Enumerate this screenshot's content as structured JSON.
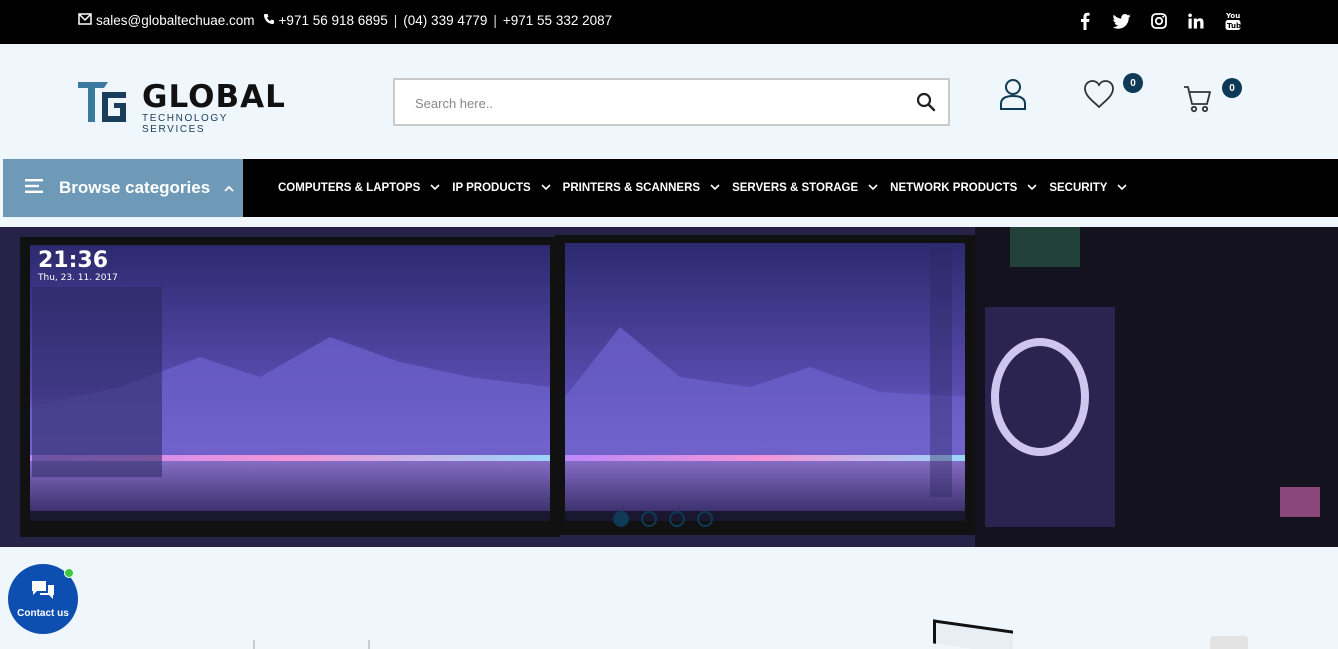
{
  "topbar": {
    "email": "sales@globaltechuae.com",
    "phones": [
      "+971 56 918 6895",
      "(04) 339 4779",
      "+971 55 332 2087"
    ],
    "socials": [
      "facebook-icon",
      "twitter-icon",
      "instagram-icon",
      "linkedin-icon",
      "youtube-icon"
    ]
  },
  "header": {
    "logo_main": "GLOBAL",
    "logo_sub": "TECHNOLOGY  SERVICES",
    "search_placeholder": "Search here..",
    "wishlist_count": "0",
    "cart_count": "0"
  },
  "nav": {
    "browse_label": "Browse categories",
    "items": [
      {
        "label": "COMPUTERS & LAPTOPS"
      },
      {
        "label": "IP PRODUCTS"
      },
      {
        "label": "PRINTERS & SCANNERS"
      },
      {
        "label": "SERVERS & STORAGE"
      },
      {
        "label": "NETWORK PRODUCTS"
      },
      {
        "label": "SECURITY"
      }
    ]
  },
  "hero": {
    "clock_time": "21:36",
    "clock_date": "Thu, 23. 11. 2017",
    "slides": 4,
    "active_slide": 0
  },
  "chat": {
    "label": "Contact us"
  },
  "colors": {
    "accent": "#0f3a55",
    "browse_bg": "#6e9ab7",
    "chat_bg": "#0d4fb0"
  }
}
